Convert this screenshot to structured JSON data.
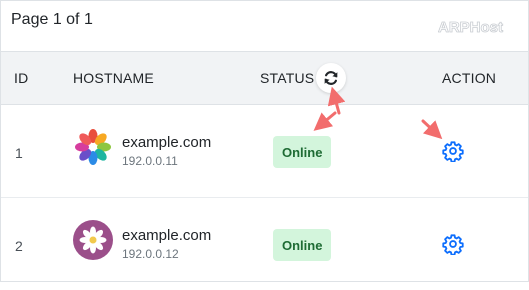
{
  "header": {
    "page_info": "Page 1 of 1",
    "brand": "ARPHost"
  },
  "table": {
    "columns": {
      "id": "ID",
      "hostname": "HOSTNAME",
      "status": "STATUS",
      "action": "ACTION"
    },
    "rows": [
      {
        "id": "1",
        "hostname": "example.com",
        "ip": "192.0.0.11",
        "status": "Online",
        "logo": "colorful-pinwheel-logo"
      },
      {
        "id": "2",
        "hostname": "example.com",
        "ip": "192.0.0.12",
        "status": "Online",
        "logo": "purple-flower-logo"
      }
    ]
  },
  "colors": {
    "accent": "#0d6efd",
    "status_online_bg": "#d3f5dc",
    "status_online_text": "#1e6b34",
    "annotation_arrow": "#f26d6d",
    "header_bg": "#f1f3f5"
  },
  "icons": {
    "refresh": "refresh-icon",
    "action": "gear-icon"
  }
}
